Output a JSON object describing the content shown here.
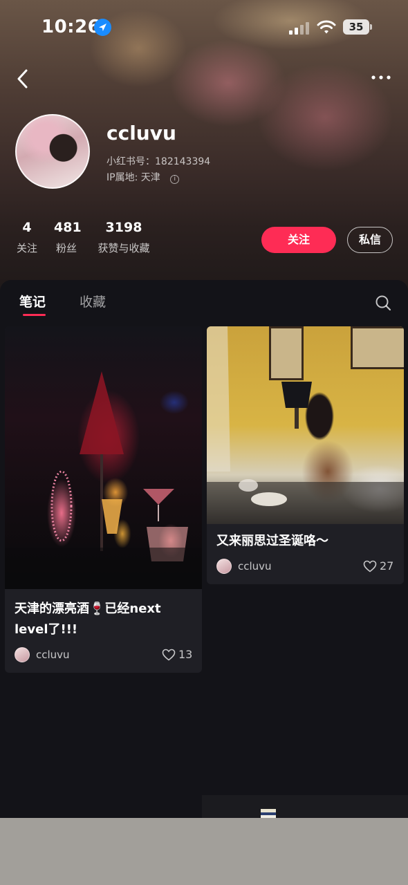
{
  "status_bar": {
    "time": "10:26",
    "battery": "35"
  },
  "profile": {
    "username": "ccluvu",
    "red_id": "小红书号：182143394",
    "ip_location": "IP属地: 天津",
    "stats": [
      {
        "value": "4",
        "label": "关注"
      },
      {
        "value": "481",
        "label": "粉丝"
      },
      {
        "value": "3198",
        "label": "获赞与收藏"
      }
    ],
    "follow_label": "关注",
    "message_label": "私信"
  },
  "tabs": [
    {
      "label": "笔记",
      "active": true
    },
    {
      "label": "收藏",
      "active": false
    }
  ],
  "notes": [
    {
      "title": "天津的漂亮酒🍷已经next level了!!!",
      "author": "ccluvu",
      "likes": "13"
    },
    {
      "title": "又来丽思过圣诞咯～",
      "author": "ccluvu",
      "likes": "27"
    }
  ],
  "colors": {
    "accent": "#fe2c55",
    "page_bg": "#131318",
    "card_bg": "#1f1f25"
  },
  "icons": [
    "back-arrow-icon",
    "more-icon",
    "location-arrow-icon",
    "search-icon",
    "heart-icon",
    "info-icon"
  ]
}
